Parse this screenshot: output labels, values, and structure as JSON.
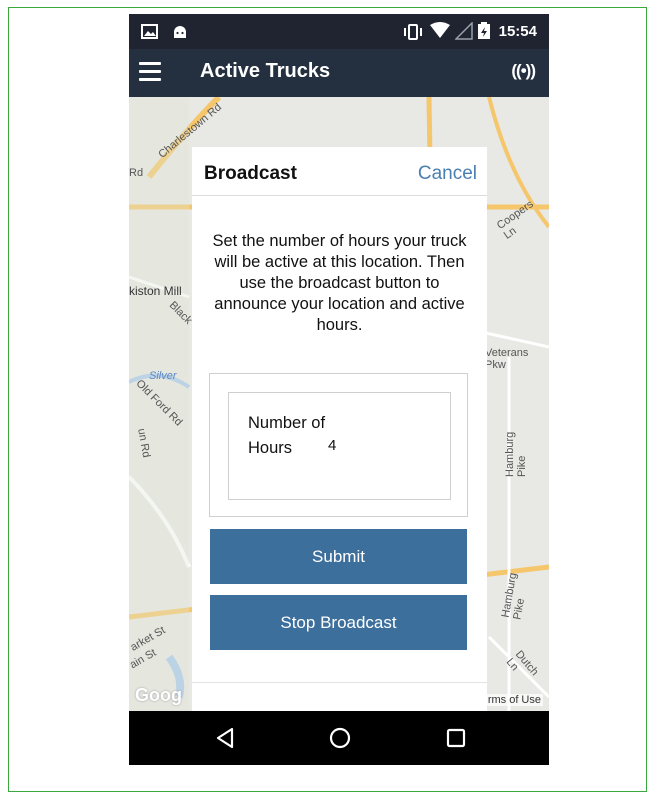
{
  "status_bar": {
    "time": "15:54"
  },
  "app_bar": {
    "title": "Active Trucks",
    "menu_icon": "hamburger-menu-icon",
    "broadcast_icon": "broadcast-icon",
    "broadcast_glyph": "((•))"
  },
  "map": {
    "labels": [
      "Charlestown Rd",
      "Coopers Ln",
      "kiston Mill",
      "Black",
      "Veterans Pkw",
      "Silver",
      "Old Ford Rd",
      "Hamburg Pike",
      "Hamburg Pike",
      "arket St",
      "ain St",
      "Dutch Ln",
      "Rd",
      "un Rd"
    ],
    "google_text": "Goog",
    "terms_text": "rms of Use"
  },
  "dialog": {
    "title": "Broadcast",
    "cancel_label": "Cancel",
    "message": "Set the number of hours your truck will be active at this location. Then use the broadcast button to announce your location and active hours.",
    "hours_label": "Number of Hours",
    "hours_value": "4",
    "submit_label": "Submit",
    "stop_label": "Stop Broadcast"
  },
  "colors": {
    "app_bar": "#243040",
    "button": "#3d6f9d",
    "cancel_link": "#4a7fb0",
    "frame_border": "#3aa83a"
  }
}
